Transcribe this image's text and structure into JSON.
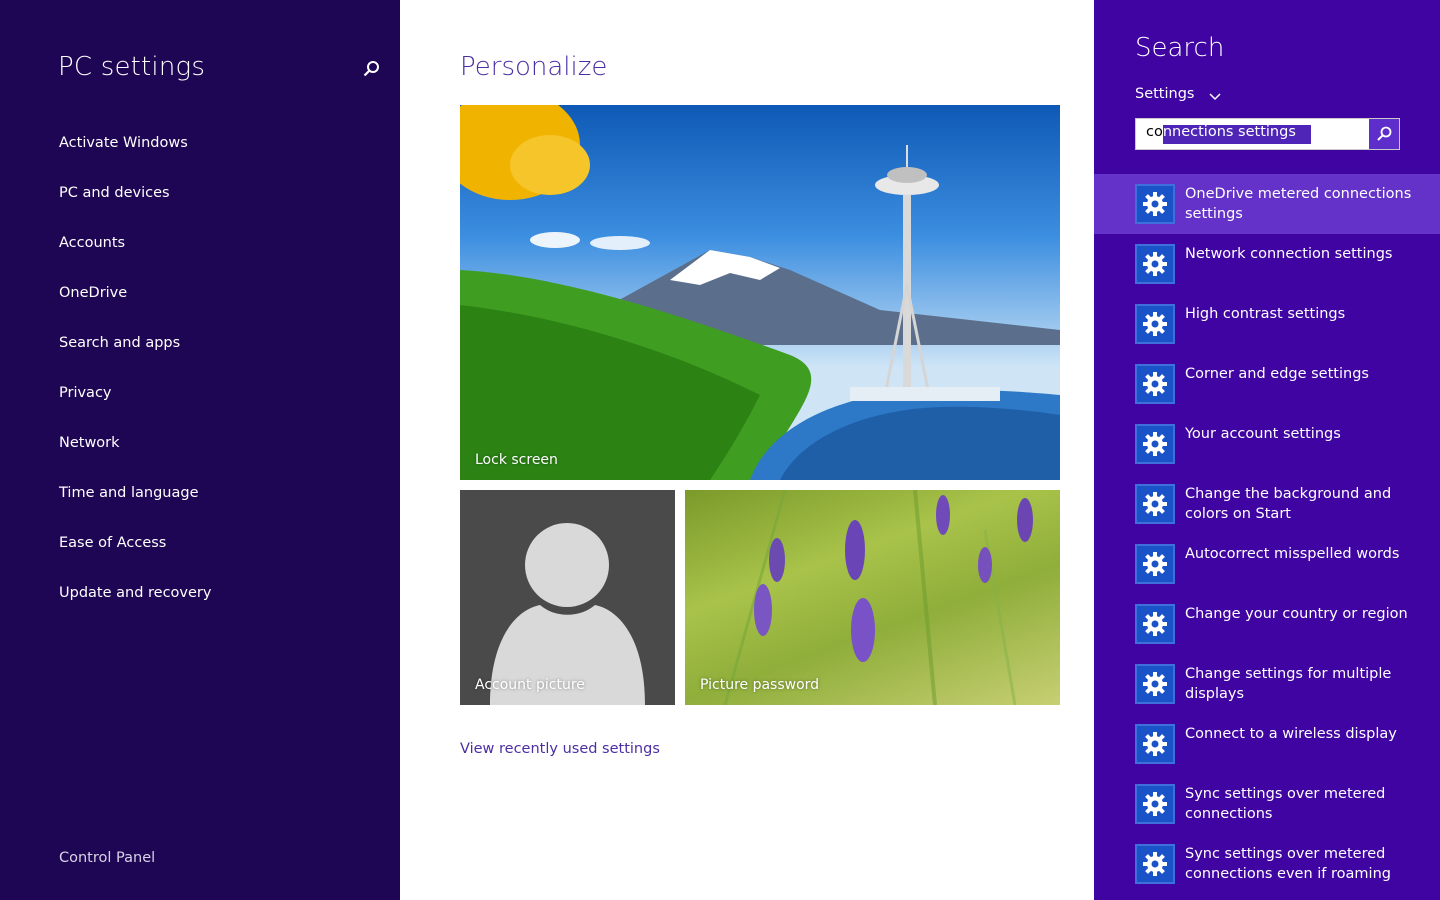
{
  "nav": {
    "title": "PC settings",
    "search_icon": "search-icon",
    "items": [
      {
        "label": "Activate Windows"
      },
      {
        "label": "PC and devices"
      },
      {
        "label": "Accounts"
      },
      {
        "label": "OneDrive"
      },
      {
        "label": "Search and apps"
      },
      {
        "label": "Privacy"
      },
      {
        "label": "Network"
      },
      {
        "label": "Time and language"
      },
      {
        "label": "Ease of Access"
      },
      {
        "label": "Update and recovery"
      }
    ],
    "footer": "Control Panel"
  },
  "main": {
    "title": "Personalize",
    "tiles": {
      "lock_screen": "Lock screen",
      "account_picture": "Account picture",
      "picture_password": "Picture password"
    },
    "recent_link": "View recently used settings"
  },
  "search_pane": {
    "title": "Search",
    "scope": "Settings",
    "query": "connections settings",
    "query_prefix": "co",
    "query_selected": "nnections settings",
    "results": [
      {
        "label": "OneDrive metered connections settings",
        "selected": true
      },
      {
        "label": "Network connection settings"
      },
      {
        "label": "High contrast settings"
      },
      {
        "label": "Corner and edge settings"
      },
      {
        "label": "Your account settings"
      },
      {
        "label": "Change the background and colors on Start"
      },
      {
        "label": "Autocorrect misspelled words"
      },
      {
        "label": "Change your country or region"
      },
      {
        "label": "Change settings for multiple displays"
      },
      {
        "label": "Connect to a wireless display"
      },
      {
        "label": "Sync settings over metered connections"
      },
      {
        "label": "Sync settings over metered connections even if roaming"
      }
    ]
  },
  "colors": {
    "nav_bg": "#1e0654",
    "pane_bg": "#3f04a1",
    "accent": "#4b2fa3",
    "selected_result": "#6432c8",
    "result_icon": "#1a52c8"
  }
}
